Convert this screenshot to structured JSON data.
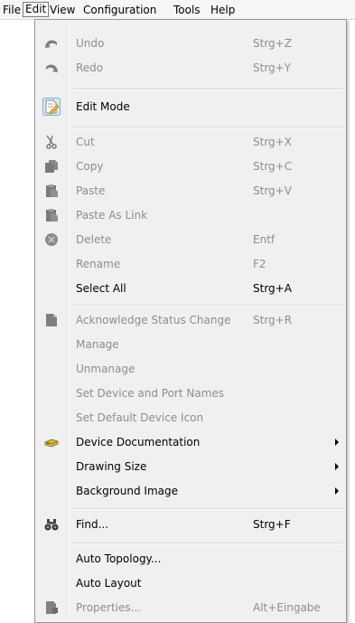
{
  "menubar": {
    "items": [
      {
        "label": "File"
      },
      {
        "label": "Edit"
      },
      {
        "label": "View"
      },
      {
        "label": "Configuration"
      },
      {
        "label": "Tools"
      },
      {
        "label": "Help"
      }
    ]
  },
  "menu": {
    "undo": {
      "label": "Undo",
      "shortcut": "Strg+Z",
      "icon": "undo-icon"
    },
    "redo": {
      "label": "Redo",
      "shortcut": "Strg+Y",
      "icon": "redo-icon"
    },
    "edit_mode": {
      "label": "Edit Mode",
      "icon": "edit-mode-icon"
    },
    "cut": {
      "label": "Cut",
      "shortcut": "Strg+X",
      "icon": "scissors-icon"
    },
    "copy": {
      "label": "Copy",
      "shortcut": "Strg+C",
      "icon": "copy-icon"
    },
    "paste": {
      "label": "Paste",
      "shortcut": "Strg+V",
      "icon": "paste-icon"
    },
    "paste_as_link": {
      "label": "Paste As Link",
      "icon": "paste-link-icon"
    },
    "delete": {
      "label": "Delete",
      "shortcut": "Entf",
      "icon": "delete-icon"
    },
    "rename": {
      "label": "Rename",
      "shortcut": "F2"
    },
    "select_all": {
      "label": "Select All",
      "shortcut": "Strg+A"
    },
    "acknowledge": {
      "label": "Acknowledge Status Change",
      "shortcut": "Strg+R",
      "icon": "acknowledge-icon"
    },
    "manage": {
      "label": "Manage"
    },
    "unmanage": {
      "label": "Unmanage"
    },
    "set_names": {
      "label": "Set Device and Port Names"
    },
    "set_icon": {
      "label": "Set Default Device Icon"
    },
    "device_docs": {
      "label": "Device Documentation",
      "icon": "device-documentation-icon"
    },
    "drawing_size": {
      "label": "Drawing Size"
    },
    "background_image": {
      "label": "Background Image"
    },
    "find": {
      "label": "Find...",
      "shortcut": "Strg+F",
      "icon": "binoculars-icon"
    },
    "auto_topology": {
      "label": "Auto Topology..."
    },
    "auto_layout": {
      "label": "Auto Layout"
    },
    "properties": {
      "label": "Properties...",
      "shortcut": "Alt+Eingabe",
      "icon": "properties-icon"
    }
  }
}
